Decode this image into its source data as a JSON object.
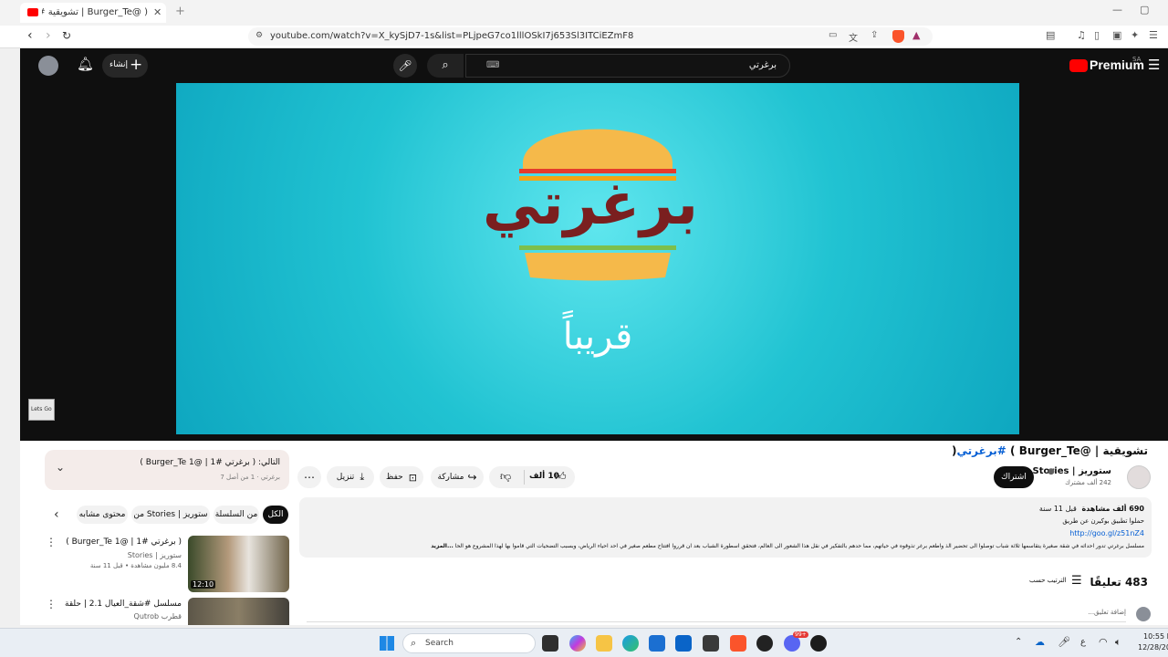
{
  "browser": {
    "tab_title": "( @Burger_Te | تشويقية #برغرتي",
    "url": "youtube.com/watch?v=X_kySjD7-1s&list=PLjpeG7co1lllOSkI7j653Sl3ITCiEZmF8"
  },
  "yt_header": {
    "premium_label": "Premium",
    "region": "SA",
    "create_label": "إنشاء",
    "search_value": "برغرتي"
  },
  "video_overlay": {
    "logo_text": "برغرتي",
    "caption": "قريباً",
    "watermark": "Lets Go"
  },
  "video_info": {
    "title_prefix": "تشويقية | @Burger_Te ) ",
    "title_hashtag": "#برغرتي",
    "title_suffix": "(",
    "channel_name": "ستوريز | Stories",
    "subscribers": "242 ألف مشترك",
    "subscribe_label": "اشتراك",
    "likes": "10 ألف",
    "share_label": "مشاركة",
    "save_label": "حفظ",
    "download_label": "تنزيل"
  },
  "description": {
    "views": "690 ألف مشاهدة",
    "age": "قبل 11 سنة",
    "line1": "حملوا تطبيق بوكيرن عن طريق",
    "link": "http://goo.gl/z51nZ4",
    "line2": "مسلسل برغرتي تدور احداثه في شقة صغيرة يتقاسمها ثلاثة شباب توصلوا الى تحضير الذ واطعم برغر تذوقوه في حياتهم، مما حدهم بالتفكير في نقل هذا الشعور الى العالم، فتحقق اسطورة الشباب بعد ان قرروا افتتاح مطعم صغير في احد احياء الرياض، وبسبب التضحيات التي قاموا بها لهذا المشروع هو الحا",
    "more": "...المزيد"
  },
  "comments": {
    "count_label": "483 تعليقًا",
    "sort_label": "الترتيب حسب",
    "add_placeholder": "إضافة تعليق..."
  },
  "playlist": {
    "next_label": "التالي: ( برغرتي #1 | @Burger_Te 1 )",
    "meta": "برغرتي · 1 من أصل 7"
  },
  "chips": [
    "الكل",
    "من السلسلة",
    "من Stories | ستوريز",
    "محتوى مشابه"
  ],
  "related": [
    {
      "title": "( برغرتي #1 | @Burger_Te 1 )",
      "channel": "ستوريز | Stories",
      "meta": "8.4 مليون مشاهدة • قبل 11 سنة",
      "duration": "12:10"
    },
    {
      "title": "مسلسل #شقة_العيال 2.1 | حلقة",
      "channel": "قطرب Qutrob",
      "meta": "",
      "duration": ""
    }
  ],
  "taskbar": {
    "search_label": "Search",
    "time": "10:55 P",
    "date": "12/28/20",
    "lang": "ع",
    "badge": "99+"
  },
  "colors": {
    "yt_red": "#ff0000",
    "video_bg": "#21c3d2",
    "burger_bun": "#f5b94a",
    "logo_brown": "#7a1f1f",
    "link_blue": "#065fd4"
  }
}
